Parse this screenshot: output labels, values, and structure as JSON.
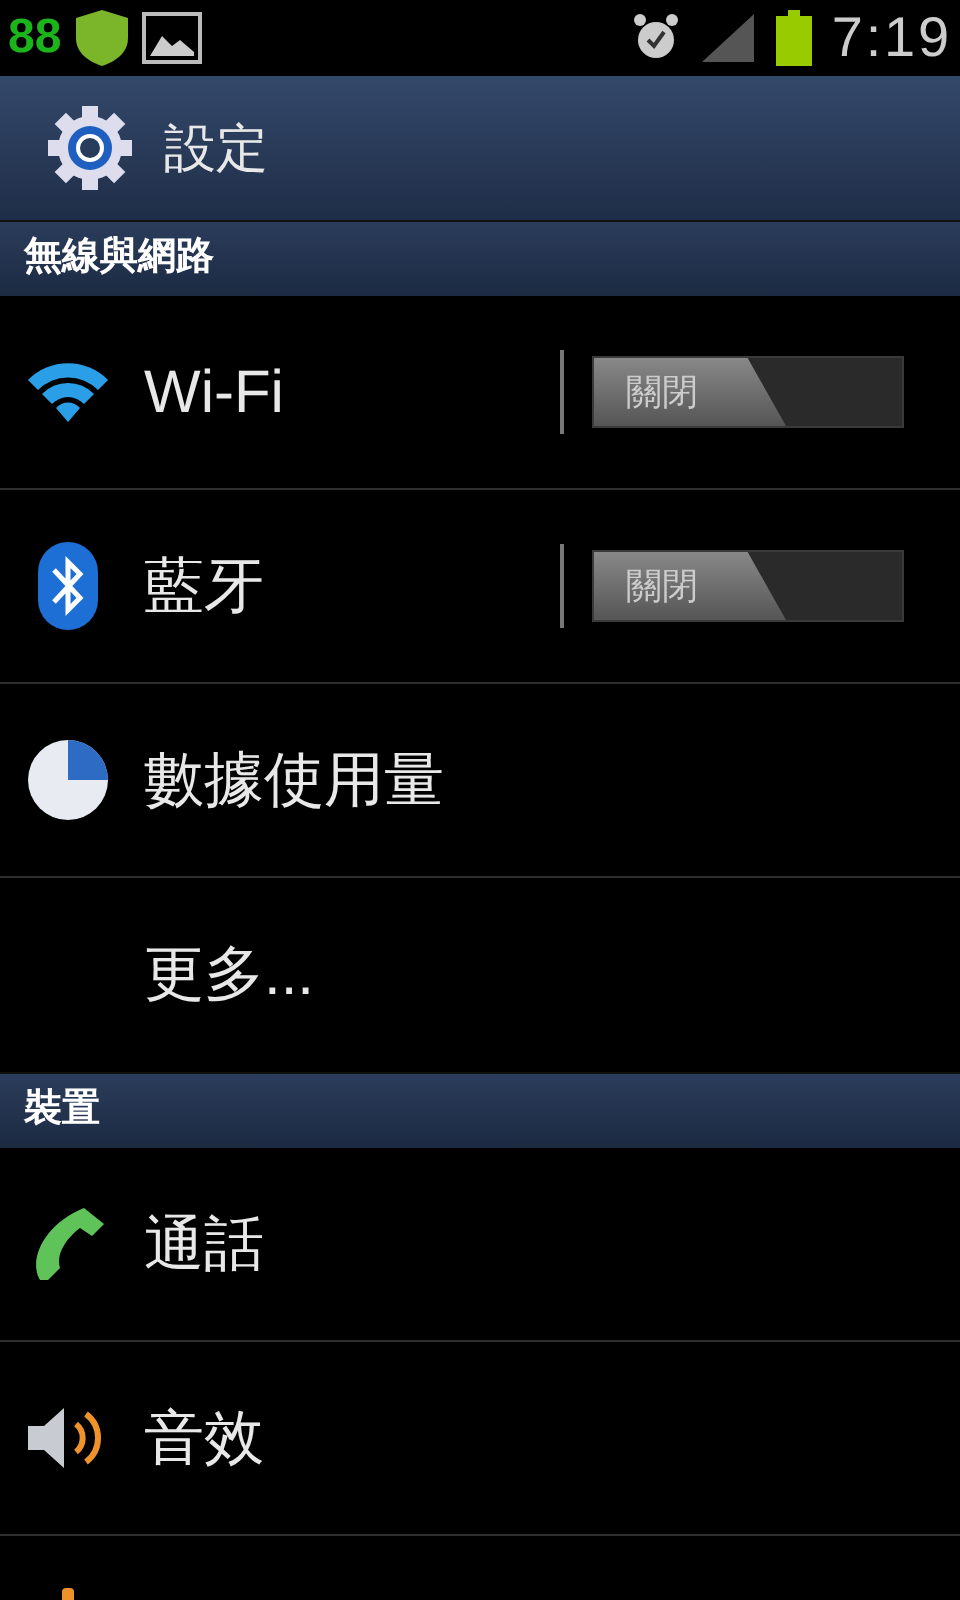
{
  "status_bar": {
    "notification_count": "88",
    "time": "7:19"
  },
  "header": {
    "title": "設定"
  },
  "sections": [
    {
      "title": "無線與網路",
      "items": [
        {
          "kind": "toggle",
          "label": "Wi-Fi",
          "on": false,
          "toggle_text": "關閉"
        },
        {
          "kind": "toggle",
          "label": "藍牙",
          "on": false,
          "toggle_text": "關閉"
        },
        {
          "kind": "plain",
          "label": "數據使用量"
        },
        {
          "kind": "plain",
          "label": "更多..."
        }
      ]
    },
    {
      "title": "裝置",
      "items": [
        {
          "kind": "plain",
          "label": "通話"
        },
        {
          "kind": "plain",
          "label": "音效"
        },
        {
          "kind": "plain"
        }
      ]
    }
  ]
}
